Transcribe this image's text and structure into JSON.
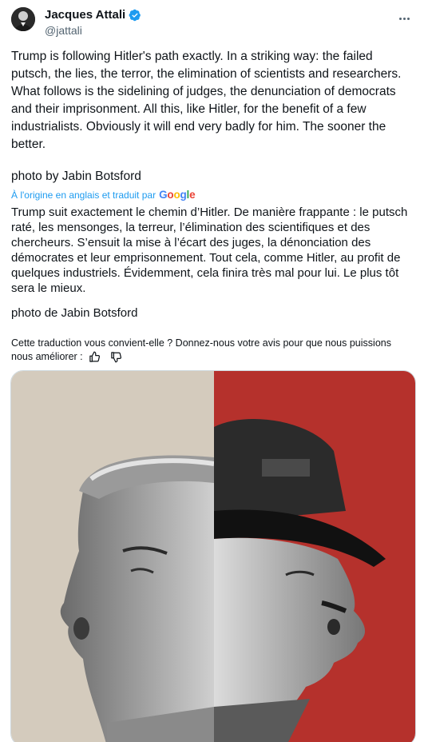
{
  "author": {
    "display_name": "Jacques Attali",
    "handle": "@jattali",
    "verified_color": "#1d9bf0"
  },
  "tweet": {
    "text_en": "Trump is following Hitler's path exactly. In a striking way: the failed putsch, the lies, the terror, the elimination of scientists and researchers. What follows is the sidelining of judges, the denunciation of democrats and their imprisonment. All this, like Hitler, for the benefit of a few industrialists. Obviously it will end very badly for him. The sooner the better.",
    "credit_en": "photo by Jabin Botsford",
    "translation_label": "À l'origine en anglais et traduit par",
    "translation_provider": "Google",
    "text_fr": "Trump suit exactement le chemin d’Hitler. De manière frappante : le putsch raté, les mensonges, la terreur, l’élimination des scientifiques et des chercheurs. S’ensuit la mise à l’écart des juges, la dénonciation des démocrates et leur emprisonnement. Tout cela, comme Hitler, au profit de quelques industriels. Évidemment, cela finira très mal pour lui. Le plus tôt sera le mieux.",
    "credit_fr": "photo de Jabin Botsford"
  },
  "feedback": {
    "prompt": "Cette traduction vous convient-elle ? Donnez-nous votre avis pour que nous puissions nous améliorer :",
    "icons": [
      "thumbs-up-icon",
      "thumbs-down-icon"
    ]
  },
  "media": {
    "left_bg": "#d4cbbd",
    "right_bg": "#b5312c"
  }
}
